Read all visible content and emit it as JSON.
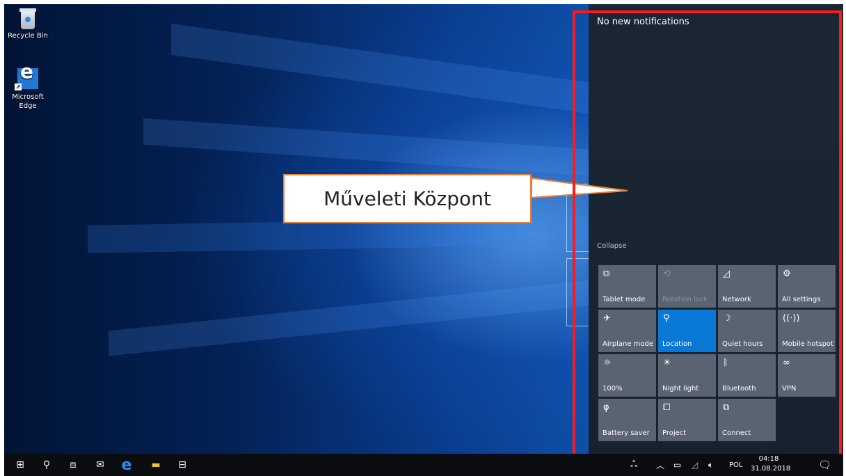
{
  "desktop": {
    "icons": [
      {
        "label": "Recycle Bin"
      },
      {
        "label": "Microsoft Edge"
      }
    ]
  },
  "action_center": {
    "header": "No new notifications",
    "collapse_label": "Collapse",
    "tiles": [
      {
        "label": "Tablet mode",
        "icon": "tablet-mode-icon",
        "state": "off"
      },
      {
        "label": "Rotation lock",
        "icon": "rotation-lock-icon",
        "state": "disabled"
      },
      {
        "label": "Network",
        "icon": "network-icon",
        "state": "off"
      },
      {
        "label": "All settings",
        "icon": "gear-icon",
        "state": "off"
      },
      {
        "label": "Airplane mode",
        "icon": "airplane-icon",
        "state": "off"
      },
      {
        "label": "Location",
        "icon": "location-icon",
        "state": "on"
      },
      {
        "label": "Quiet hours",
        "icon": "moon-icon",
        "state": "off"
      },
      {
        "label": "Mobile hotspot",
        "icon": "hotspot-icon",
        "state": "off"
      },
      {
        "label": "100%",
        "icon": "brightness-icon",
        "state": "off"
      },
      {
        "label": "Night light",
        "icon": "night-light-icon",
        "state": "off"
      },
      {
        "label": "Bluetooth",
        "icon": "bluetooth-icon",
        "state": "off"
      },
      {
        "label": "VPN",
        "icon": "vpn-icon",
        "state": "off"
      },
      {
        "label": "Battery saver",
        "icon": "battery-saver-icon",
        "state": "off"
      },
      {
        "label": "Project",
        "icon": "project-icon",
        "state": "off"
      },
      {
        "label": "Connect",
        "icon": "connect-icon",
        "state": "off"
      }
    ]
  },
  "callout": {
    "text": "Műveleti Központ"
  },
  "taskbar": {
    "language": "POL",
    "time": "04:18",
    "date": "31.08.2018"
  },
  "colors": {
    "accent": "#0a78d7",
    "highlight": "#ff1a1a",
    "callout_border": "#ed7d31"
  }
}
